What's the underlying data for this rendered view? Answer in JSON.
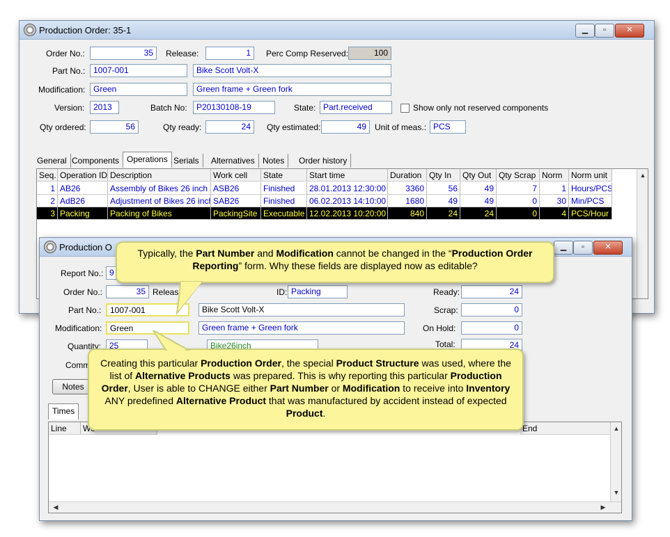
{
  "main_window": {
    "title": "Production Order: 35-1",
    "win_buttons": {
      "minimize": "▁",
      "maximize": "▫",
      "close": "✕"
    },
    "fields": {
      "order_no_label": "Order No.:",
      "order_no": "35",
      "release_label": "Release:",
      "release": "1",
      "perc_comp_label": "Perc Comp Reserved:",
      "perc_comp": "100",
      "part_no_label": "Part No.:",
      "part_no": "1007-001",
      "part_desc": "Bike Scott Volt-X",
      "modification_label": "Modification:",
      "modification": "Green",
      "modification_desc": "Green frame + Green fork",
      "version_label": "Version:",
      "version": "2013",
      "batch_no_label": "Batch No:",
      "batch_no": "P20130108-19",
      "state_label": "State:",
      "state": "Part.received",
      "show_only_label": "Show only not reserved components",
      "qty_ordered_label": "Qty ordered:",
      "qty_ordered": "56",
      "qty_ready_label": "Qty ready:",
      "qty_ready": "24",
      "qty_estimated_label": "Qty estimated:",
      "qty_estimated": "49",
      "unit_label": "Unit of meas.:",
      "unit": "PCS"
    },
    "tabs": [
      "General",
      "Components",
      "Operations",
      "Serials",
      "Alternatives",
      "Notes",
      "Order history"
    ],
    "active_tab": "Operations",
    "grid": {
      "columns": [
        "Seq.",
        "Operation ID",
        "Description",
        "Work cell",
        "State",
        "Start time",
        "Duration",
        "Qty In",
        "Qty Out",
        "Qty Scrap",
        "Norm",
        "Norm unit"
      ],
      "rows": [
        [
          "1",
          "AB26",
          "Assembly of Bikes 26 inch",
          "ASB26",
          "Finished",
          "28.01.2013 12:30:00",
          "3360",
          "56",
          "49",
          "7",
          "1",
          "Hours/PCS"
        ],
        [
          "2",
          "AdB26",
          "Adjustment of Bikes 26 inch",
          "SAB26",
          "Finished",
          "06.02.2013 14:10:00",
          "1680",
          "49",
          "49",
          "0",
          "30",
          "Min/PCS"
        ],
        [
          "3",
          "Packing",
          "Packing of Bikes",
          "PackingSite",
          "Executable",
          "12.02.2013 10:20:00",
          "840",
          "24",
          "24",
          "0",
          "4",
          "PCS/Hour"
        ]
      ]
    }
  },
  "report_window": {
    "title": "Production O",
    "fields": {
      "report_no_label": "Report No.:",
      "report_no": "9",
      "order_no_label": "Order No.:",
      "order_no": "35",
      "release_label": "Release:",
      "op_id_label": "ID:",
      "op_id": "Packing",
      "ready_label": "Ready:",
      "ready": "24",
      "part_no_label": "Part No.:",
      "part_no": "1007-001",
      "part_desc": "Bike Scott Volt-X",
      "scrap_label": "Scrap:",
      "scrap": "0",
      "modification_label": "Modification:",
      "modification": "Green",
      "modification_desc": "Green frame + Green fork",
      "on_hold_label": "On Hold:",
      "on_hold": "0",
      "quantity_label": "Quantity:",
      "quantity": "25",
      "work_cell_partial": "Bike26inch",
      "total_label": "Total:",
      "total": "24",
      "comment_label": "Comm"
    },
    "notes_button": "Notes",
    "tabs": [
      "Times"
    ],
    "grid_columns": [
      "Line",
      "Wo",
      "End"
    ]
  },
  "callouts": {
    "top": [
      {
        "t": "Typically, the ",
        "b": false
      },
      {
        "t": "Part Number",
        "b": true
      },
      {
        "t": " and ",
        "b": false
      },
      {
        "t": "Modification",
        "b": true
      },
      {
        "t": " cannot be changed in the “",
        "b": false
      },
      {
        "t": "Production Order Reporting",
        "b": true
      },
      {
        "t": "” form. Why these fields are displayed now as editable?",
        "b": false
      }
    ],
    "bottom": [
      {
        "t": "Creating this particular ",
        "b": false
      },
      {
        "t": "Production Order",
        "b": true
      },
      {
        "t": ", the special ",
        "b": false
      },
      {
        "t": "Product Structure",
        "b": true
      },
      {
        "t": " was used, where the list of ",
        "b": false
      },
      {
        "t": "Alternative Products",
        "b": true
      },
      {
        "t": " was prepared. This is why reporting this particular ",
        "b": false
      },
      {
        "t": "Production Order",
        "b": true
      },
      {
        "t": ", User is able to CHANGE either ",
        "b": false
      },
      {
        "t": "Part Number",
        "b": true
      },
      {
        "t": " or ",
        "b": false
      },
      {
        "t": "Modification",
        "b": true
      },
      {
        "t": " to receive into ",
        "b": false
      },
      {
        "t": "Inventory",
        "b": true
      },
      {
        "t": " ANY predefined ",
        "b": false
      },
      {
        "t": "Alternative Product",
        "b": true
      },
      {
        "t": " that was manufactured by accident instead of expected ",
        "b": false
      },
      {
        "t": "Product",
        "b": true
      },
      {
        "t": ".",
        "b": false
      }
    ]
  }
}
